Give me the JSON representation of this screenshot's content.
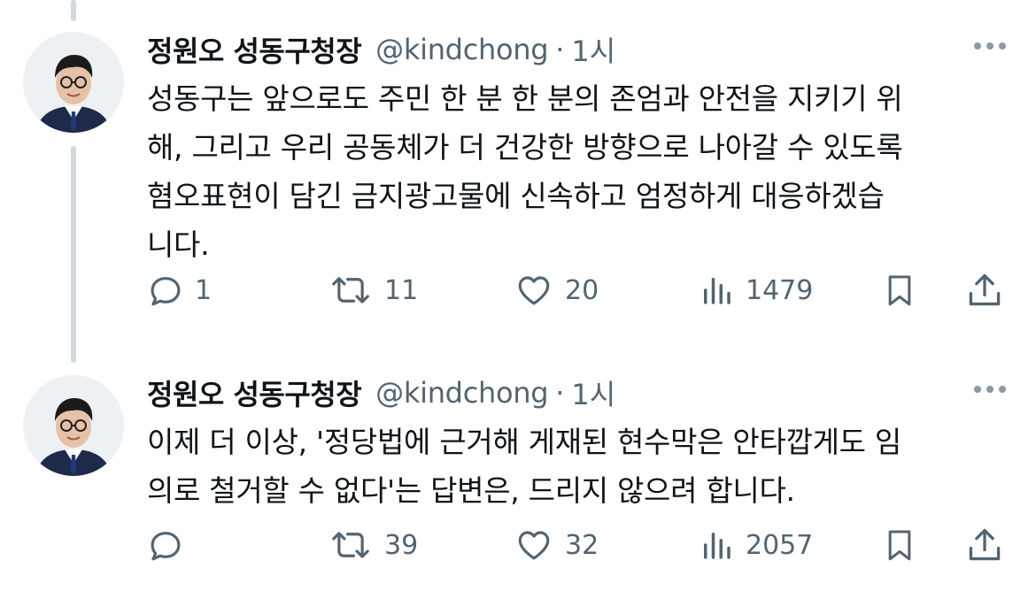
{
  "tweets": [
    {
      "author": {
        "display_name": "정원오 성동구청장",
        "handle": "@kindchong",
        "separator": "·",
        "time": "1시"
      },
      "text_lines": [
        "성동구는 앞으로도 주민 한 분 한 분의 존엄과 안전을 지키기 위",
        "해, 그리고 우리 공동체가 더 건강한 방향으로 나아갈 수 있도록",
        "혐오표현이 담긴 금지광고물에 신속하고 엄정하게 대응하겠습",
        "니다."
      ],
      "metrics": {
        "replies": "1",
        "retweets": "11",
        "likes": "20",
        "views": "1479"
      }
    },
    {
      "author": {
        "display_name": "정원오 성동구청장",
        "handle": "@kindchong",
        "separator": "·",
        "time": "1시"
      },
      "text_lines": [
        "이제 더 이상, '정당법에 근거해 게재된 현수막은 안타깝게도 임",
        "의로 철거할 수 없다'는 답변은, 드리지 않으려 합니다."
      ],
      "metrics": {
        "replies": "",
        "retweets": "39",
        "likes": "32",
        "views": "2057"
      }
    }
  ],
  "icons": {
    "reply": "reply-icon",
    "retweet": "retweet-icon",
    "like": "heart-icon",
    "views": "views-icon",
    "bookmark": "bookmark-icon",
    "share": "share-icon",
    "more": "more-icon"
  },
  "colors": {
    "text": "#0f1419",
    "muted": "#536471",
    "thread_line": "#cfd9de"
  }
}
